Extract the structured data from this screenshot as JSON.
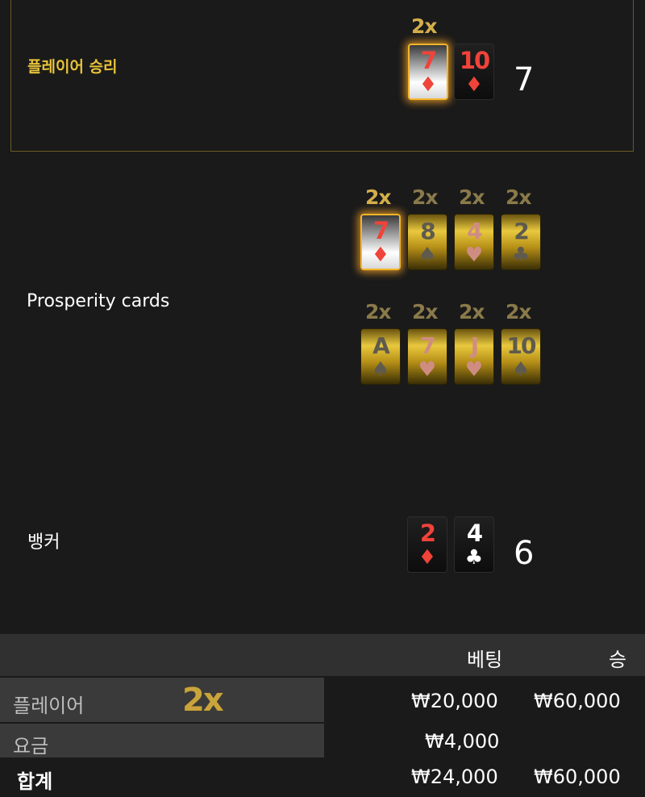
{
  "player": {
    "label": "플레이어 승리",
    "score": "7",
    "multiplier": "2x",
    "cards": [
      {
        "rank": "7",
        "suit": "♦",
        "color": "red",
        "highlighted": true
      },
      {
        "rank": "10",
        "suit": "♦",
        "color": "red",
        "highlighted": false
      }
    ]
  },
  "prosperity": {
    "label": "Prosperity cards",
    "cards": [
      {
        "rank": "7",
        "suit": "♦",
        "multiplier": "2x",
        "highlighted": true
      },
      {
        "rank": "8",
        "suit": "♠",
        "multiplier": "2x",
        "highlighted": false
      },
      {
        "rank": "4",
        "suit": "♥",
        "multiplier": "2x",
        "highlighted": false
      },
      {
        "rank": "2",
        "suit": "♣",
        "multiplier": "2x",
        "highlighted": false
      },
      {
        "rank": "A",
        "suit": "♠",
        "multiplier": "2x",
        "highlighted": false
      },
      {
        "rank": "7",
        "suit": "♥",
        "multiplier": "2x",
        "highlighted": false
      },
      {
        "rank": "J",
        "suit": "♥",
        "multiplier": "2x",
        "highlighted": false
      },
      {
        "rank": "10",
        "suit": "♠",
        "multiplier": "2x",
        "highlighted": false
      }
    ]
  },
  "banker": {
    "label": "뱅커",
    "score": "6",
    "cards": [
      {
        "rank": "2",
        "suit": "♦",
        "color": "red"
      },
      {
        "rank": "4",
        "suit": "♣",
        "color": "black"
      }
    ]
  },
  "table": {
    "headers": {
      "bet": "베팅",
      "win": "승"
    },
    "rows": [
      {
        "label": "플레이어",
        "multiplier": "2x",
        "bet": "₩20,000",
        "win": "₩60,000"
      },
      {
        "label": "요금",
        "bet": "₩4,000",
        "win": ""
      },
      {
        "label": "합계",
        "bet": "₩24,000",
        "win": "₩60,000"
      }
    ]
  },
  "colors": {
    "accent_gold": "#e8c33a",
    "card_red": "#f0433a",
    "glow": "#f3b52a",
    "background": "#1a1a1a"
  }
}
